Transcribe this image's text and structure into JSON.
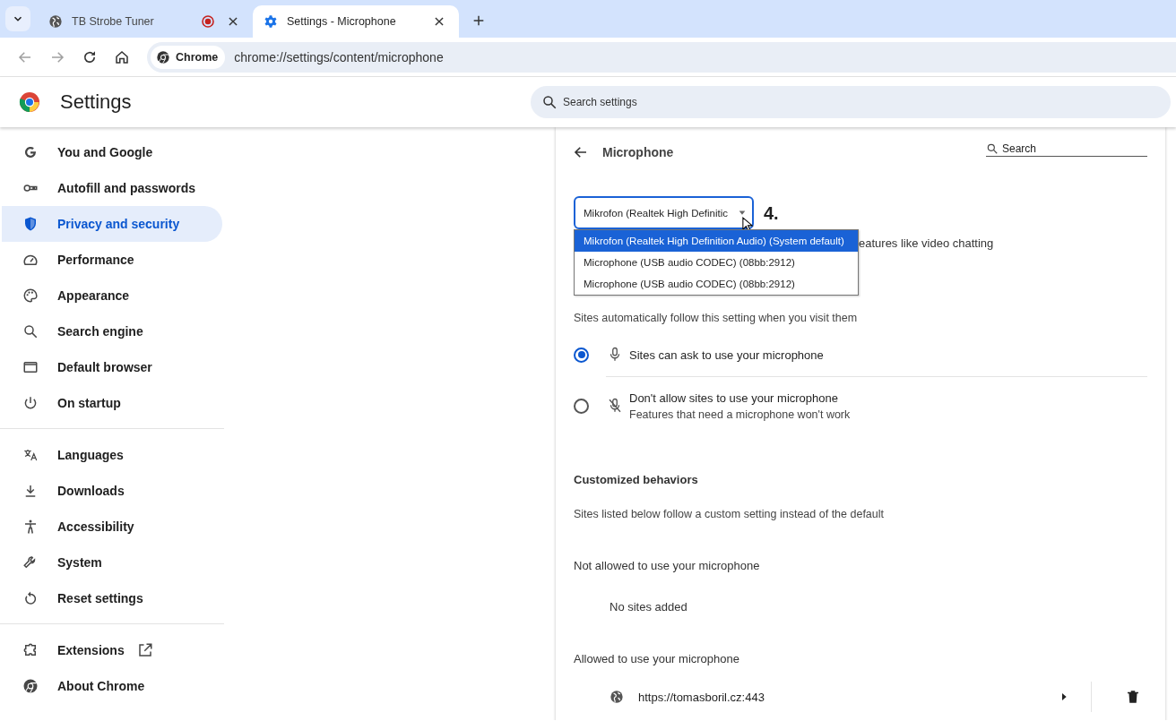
{
  "tabs": [
    {
      "title": "TB Strobe Tuner",
      "selected": false,
      "recording": true
    },
    {
      "title": "Settings - Microphone",
      "selected": true,
      "recording": false
    }
  ],
  "toolbar": {
    "chip": "Chrome",
    "url": "chrome://settings/content/microphone"
  },
  "header": {
    "title": "Settings",
    "search_placeholder": "Search settings"
  },
  "sidebar": {
    "groups": [
      [
        {
          "label": "You and Google",
          "selected": false
        },
        {
          "label": "Autofill and passwords",
          "selected": false
        },
        {
          "label": "Privacy and security",
          "selected": true
        },
        {
          "label": "Performance",
          "selected": false
        },
        {
          "label": "Appearance",
          "selected": false
        },
        {
          "label": "Search engine",
          "selected": false
        },
        {
          "label": "Default browser",
          "selected": false
        },
        {
          "label": "On startup",
          "selected": false
        }
      ],
      [
        {
          "label": "Languages",
          "selected": false
        },
        {
          "label": "Downloads",
          "selected": false
        },
        {
          "label": "Accessibility",
          "selected": false
        },
        {
          "label": "System",
          "selected": false
        },
        {
          "label": "Reset settings",
          "selected": false
        }
      ],
      [
        {
          "label": "Extensions",
          "selected": false,
          "external": true
        },
        {
          "label": "About Chrome",
          "selected": false,
          "external": false
        }
      ]
    ]
  },
  "content": {
    "title": "Microphone",
    "search_placeholder": "Search",
    "device_select": {
      "value": "Mikrofon (Realtek High Definitic",
      "annotation": "4.",
      "options": [
        {
          "label": "Mikrofon (Realtek High Definition Audio) (System default)",
          "selected": true
        },
        {
          "label": "Microphone (USB audio CODEC) (08bb:2912)",
          "selected": false
        },
        {
          "label": "Microphone (USB audio CODEC) (08bb:2912)",
          "selected": false
        }
      ]
    },
    "description": "eatures like video chatting",
    "default_hint": "Sites automatically follow this setting when you visit them",
    "options": [
      {
        "label": "Sites can ask to use your microphone",
        "selected": true,
        "muted": false
      },
      {
        "label": "Don't allow sites to use your microphone",
        "sublabel": "Features that need a microphone won't work",
        "selected": false,
        "muted": true
      }
    ],
    "custom_title": "Customized behaviors",
    "custom_hint": "Sites listed below follow a custom setting instead of the default",
    "blocked": {
      "title": "Not allowed to use your microphone",
      "empty": "No sites added"
    },
    "allowed": {
      "title": "Allowed to use your microphone",
      "sites": [
        "https://tomasboril.cz:443"
      ]
    }
  }
}
